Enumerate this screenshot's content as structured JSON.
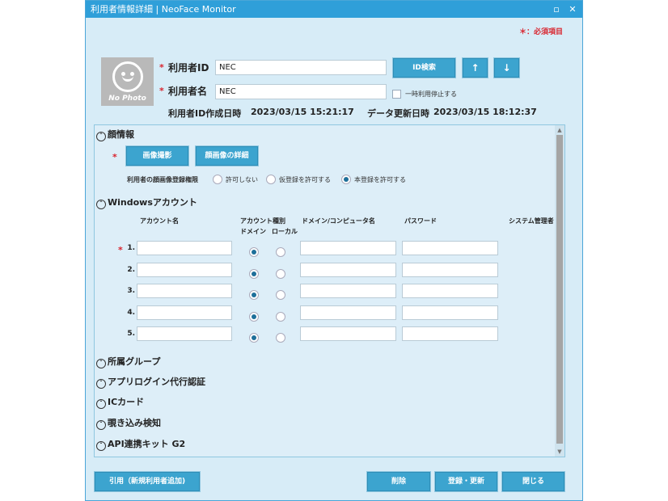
{
  "window": {
    "title": "利用者情報詳細 | NeoFace Monitor",
    "restore_glyph": "▫",
    "close_glyph": "✕"
  },
  "legend": {
    "required_note": "＊：必須項目"
  },
  "photo": {
    "caption": "No Photo"
  },
  "fields": {
    "user_id_label": "利用者ID",
    "user_id_value": "NEC",
    "user_name_label": "利用者名",
    "user_name_value": "NEC",
    "required_mark": "*"
  },
  "buttons": {
    "id_search": "ID検索",
    "up": "↑",
    "down": "↓",
    "capture": "画像撮影",
    "image_detail": "顔画像の詳細",
    "quote": "引用（新規利用者追加)",
    "delete": "削除",
    "register": "登録・更新",
    "close": "閉じる"
  },
  "suspend": {
    "label": "一時利用停止する"
  },
  "meta": {
    "created_label": "利用者ID作成日時",
    "created_value": "2023/03/15 15:21:17",
    "updated_label": "データ更新日時",
    "updated_value": "2023/03/15 18:12:37"
  },
  "face_section": {
    "title": "顔情報",
    "permission_label": "利用者の顔画像登録権限",
    "options": [
      "許可しない",
      "仮登録を許可する",
      "本登録を許可する"
    ],
    "selected": 2
  },
  "windows_section": {
    "title": "Windowsアカウント",
    "col_account": "アカウント名",
    "col_type": "アカウント種別",
    "col_domain": "ドメイン",
    "col_local": "ローカル",
    "col_domain_computer": "ドメイン/コンピュータ名",
    "col_password": "パスワード",
    "col_admin": "システム管理者",
    "rows": [
      {
        "num": "1.",
        "type": "domain"
      },
      {
        "num": "2.",
        "type": "domain"
      },
      {
        "num": "3.",
        "type": "domain"
      },
      {
        "num": "4.",
        "type": "domain"
      },
      {
        "num": "5.",
        "type": "domain"
      }
    ]
  },
  "collapsed_sections": [
    "所属グループ",
    "アプリログイン代行認証",
    "ICカード",
    "覗き込み検知",
    "API連携キット G2"
  ],
  "icons": {
    "expanded": "chevron-up-icon",
    "collapsed": "chevron-down-icon",
    "expanded_glyph": "ˆ",
    "collapsed_glyph": "ˇ"
  },
  "colors": {
    "accent": "#3ca4cf",
    "titlebar": "#2f9fd9",
    "required": "#d9232d",
    "background": "#d7ecf7"
  }
}
